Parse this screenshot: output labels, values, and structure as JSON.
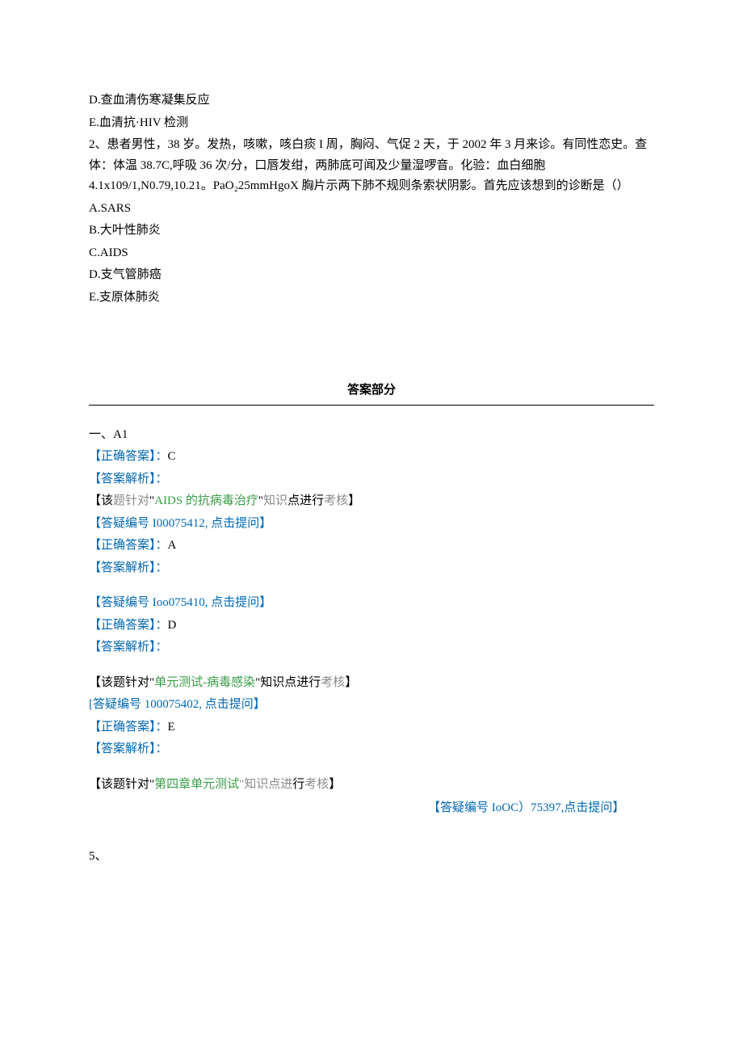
{
  "question1_tail": {
    "optionD": "D.查血清伤寒凝集反应",
    "optionE": "E.血清抗·HIV 检测"
  },
  "question2": {
    "stem": "2、患者男性，38 岁。发热，咳嗽，咳白痰 I 周，胸闷、气促 2 天，于 2002 年 3 月来诊。有同性恋史。查体：体温 38.7C,呼吸 36 次/分，口唇发绀，两肺底可闻及少量湿啰音。化验：血白细胞 4.1x109/1,N0.79,10.21。PaO₂25mmHgoX 胸片示两下肺不规则条索状阴影。首先应该想到的诊断是（）",
    "optionA": "A.SARS",
    "optionB": "B.大叶性肺炎",
    "optionC": "C.AIDS",
    "optionD": "D.支气管肺癌",
    "optionE": "E.支原体肺炎"
  },
  "answerSection": {
    "title": "答案部分",
    "heading": "一、A1",
    "items": [
      {
        "correct_label": "【正确答案】：",
        "correct_value": "C",
        "analysis_label": "【答案解析】：",
        "topic_prefix": "【该",
        "topic_gray": "题针对",
        "topic_quote_open": "\"",
        "topic_green": "AIDS 的抗病毒治疗",
        "topic_quote_close": "\"",
        "topic_gray2": "知识",
        "topic_mid": "点进行",
        "topic_gray3": "考核",
        "topic_suffix": "】",
        "faq": "【答疑编号 I00075412, 点击提问】"
      },
      {
        "correct_label": "【正确答案】：",
        "correct_value": "A",
        "analysis_label": "【答案解析】：",
        "faq": "【答疑编号 Ioo075410, 点击提问】"
      },
      {
        "correct_label": "【正确答案】：",
        "correct_value": "D",
        "analysis_label": "【答案解析】：",
        "topic_prefix": "【该题针对\"",
        "topic_green": "单元测试-病毒感染",
        "topic_mid": "\"知识点进行",
        "topic_gray3": "考核",
        "topic_suffix": "】",
        "faq_open": "[",
        "faq_text": "答疑编号 100075402, 点击提问",
        "faq_close": "】"
      },
      {
        "correct_label": "【正确答案】：",
        "correct_value": "E",
        "analysis_label": "【答案解析】：",
        "topic_prefix": "【该题针对\"",
        "topic_green": "第四章单元测试",
        "topic_gray_mid": "\"知识点进",
        "topic_black_mid": "行",
        "topic_gray3": "考核",
        "topic_suffix": "】",
        "faq": "【答疑编号 IoOC）75397,点击提问】"
      }
    ],
    "q5": "5、"
  }
}
